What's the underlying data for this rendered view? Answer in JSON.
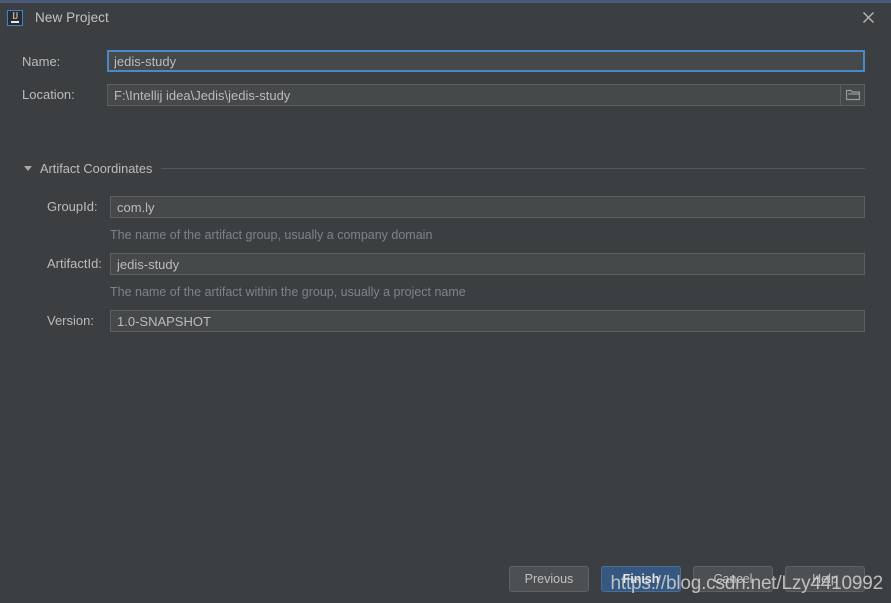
{
  "window": {
    "title": "New Project",
    "app_icon_name": "intellij-idea-icon",
    "app_icon_text": "IJ",
    "close_icon_name": "close-icon",
    "accent_color": "#4a5a78",
    "background_color": "#3c3f41"
  },
  "fields": {
    "name": {
      "label": "Name:",
      "value": "jedis-study",
      "placeholder": "",
      "focused": true,
      "focus_border_color": "#4a88c7"
    },
    "location": {
      "label": "Location:",
      "value": "F:\\Intellij idea\\Jedis\\jedis-study",
      "placeholder": "",
      "browse_icon_name": "folder-icon"
    }
  },
  "artifact_section": {
    "title": "Artifact Coordinates",
    "expanded": true,
    "collapse_icon_name": "chevron-down-icon",
    "fields": [
      {
        "label": "GroupId:",
        "value": "com.ly",
        "placeholder": "",
        "hint": "The name of the artifact group, usually a company domain"
      },
      {
        "label": "ArtifactId:",
        "value": "jedis-study",
        "placeholder": "",
        "hint": "The name of the artifact within the group, usually a project name"
      },
      {
        "label": "Version:",
        "value": "1.0-SNAPSHOT",
        "placeholder": "",
        "hint": ""
      }
    ]
  },
  "buttons": {
    "previous": "Previous",
    "finish": "Finish",
    "cancel": "Cancel",
    "help": "Help",
    "primary_color": "#365880"
  },
  "watermark": {
    "text": "https://blog.csdn.net/Lzy4410992"
  }
}
